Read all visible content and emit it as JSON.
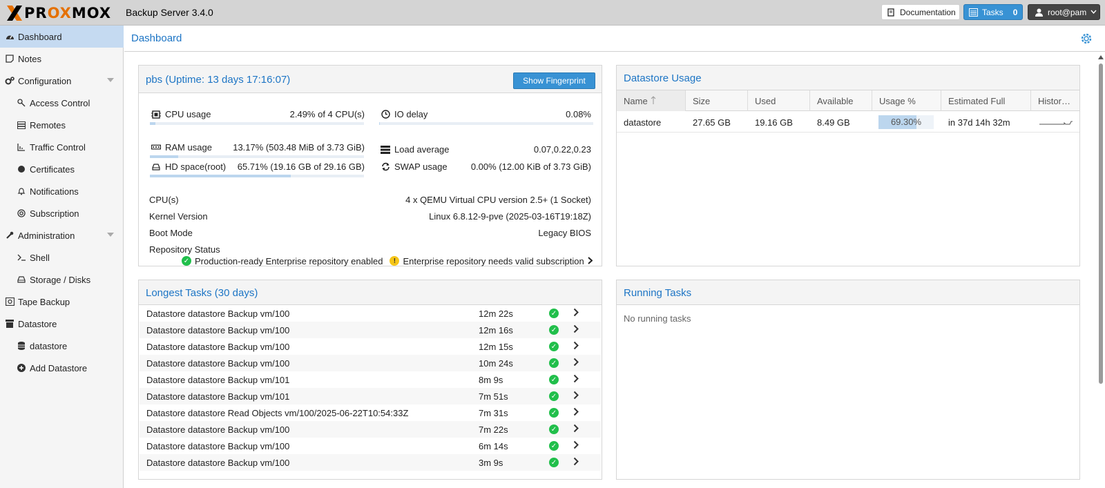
{
  "header": {
    "logo_text_pr": "PR",
    "logo_text_o1": "O",
    "logo_text_x": "X",
    "logo_text_m": "M",
    "logo_text_o2": "O",
    "logo_text_x2": "X",
    "product": "Backup Server 3.4.0",
    "documentation": "Documentation",
    "tasks_label": "Tasks",
    "tasks_count": "0",
    "user": "root@pam"
  },
  "sidebar": {
    "items": [
      {
        "label": "Dashboard",
        "icon": "dashboard-icon"
      },
      {
        "label": "Notes",
        "icon": "notes-icon"
      },
      {
        "label": "Configuration",
        "icon": "cogs-icon"
      },
      {
        "label": "Access Control",
        "icon": "key-icon"
      },
      {
        "label": "Remotes",
        "icon": "server-icon"
      },
      {
        "label": "Traffic Control",
        "icon": "chart-icon"
      },
      {
        "label": "Certificates",
        "icon": "certificate-icon"
      },
      {
        "label": "Notifications",
        "icon": "bell-icon"
      },
      {
        "label": "Subscription",
        "icon": "support-icon"
      },
      {
        "label": "Administration",
        "icon": "wrench-icon"
      },
      {
        "label": "Shell",
        "icon": "terminal-icon"
      },
      {
        "label": "Storage / Disks",
        "icon": "hdd-icon"
      },
      {
        "label": "Tape Backup",
        "icon": "tape-icon"
      },
      {
        "label": "Datastore",
        "icon": "archive-icon"
      },
      {
        "label": "datastore",
        "icon": "database-icon"
      },
      {
        "label": "Add Datastore",
        "icon": "plus-circle-icon"
      }
    ]
  },
  "main": {
    "title": "Dashboard"
  },
  "server_panel": {
    "title": "pbs (Uptime: 13 days 17:16:07)",
    "fingerprint_button": "Show Fingerprint",
    "cpu_label": "CPU usage",
    "cpu_value": "2.49% of 4 CPU(s)",
    "cpu_fraction": 0.0249,
    "io_label": "IO delay",
    "io_value": "0.08%",
    "io_fraction": 0.0008,
    "ram_label": "RAM usage",
    "ram_value": "13.17% (503.48 MiB of 3.73 GiB)",
    "ram_fraction": 0.1317,
    "load_label": "Load average",
    "load_value": "0.07,0.22,0.23",
    "hd_label": "HD space(root)",
    "hd_value": "65.71% (19.16 GB of 29.16 GB)",
    "hd_fraction": 0.6571,
    "swap_label": "SWAP usage",
    "swap_value": "0.00% (12.00 KiB of 3.73 GiB)",
    "swap_fraction": 0.0,
    "cpus_label": "CPU(s)",
    "cpus_value": "4 x QEMU Virtual CPU version 2.5+ (1 Socket)",
    "kernel_label": "Kernel Version",
    "kernel_value": "Linux 6.8.12-9-pve (2025-03-16T19:18Z)",
    "boot_label": "Boot Mode",
    "boot_value": "Legacy BIOS",
    "repo_label": "Repository Status",
    "repo_ok": "Production-ready Enterprise repository enabled",
    "repo_warn": "Enterprise repository needs valid subscription"
  },
  "datastore_panel": {
    "title": "Datastore Usage",
    "columns": [
      "Name",
      "Size",
      "Used",
      "Available",
      "Usage %",
      "Estimated Full",
      "Histor…"
    ],
    "row": {
      "name": "datastore",
      "size": "27.65 GB",
      "used": "19.16 GB",
      "available": "8.49 GB",
      "usage": "69.30%",
      "usage_fraction": 0.693,
      "estimated_full": "in 37d 14h 32m"
    }
  },
  "longest_tasks": {
    "title": "Longest Tasks (30 days)",
    "rows": [
      {
        "name": "Datastore datastore Backup vm/100",
        "duration": "12m 22s"
      },
      {
        "name": "Datastore datastore Backup vm/100",
        "duration": "12m 16s"
      },
      {
        "name": "Datastore datastore Backup vm/100",
        "duration": "12m 15s"
      },
      {
        "name": "Datastore datastore Backup vm/100",
        "duration": "10m 24s"
      },
      {
        "name": "Datastore datastore Backup vm/101",
        "duration": "8m 9s"
      },
      {
        "name": "Datastore datastore Backup vm/101",
        "duration": "7m 51s"
      },
      {
        "name": "Datastore datastore Read Objects vm/100/2025-06-22T10:54:33Z",
        "duration": "7m 31s"
      },
      {
        "name": "Datastore datastore Backup vm/100",
        "duration": "7m 22s"
      },
      {
        "name": "Datastore datastore Backup vm/100",
        "duration": "6m 14s"
      },
      {
        "name": "Datastore datastore Backup vm/100",
        "duration": "3m 9s"
      }
    ]
  },
  "running_tasks": {
    "title": "Running Tasks",
    "empty": "No running tasks"
  },
  "colors": {
    "accent": "#1d75c5",
    "button": "#3892d4",
    "ok": "#21bf4b",
    "warn": "#f5c518",
    "brand_orange": "#e57000"
  }
}
